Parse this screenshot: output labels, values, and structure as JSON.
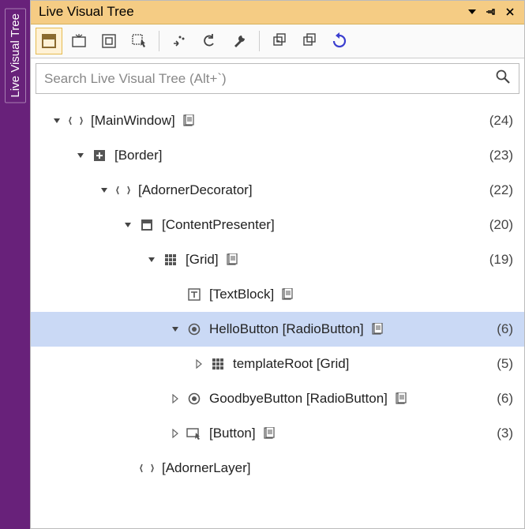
{
  "side_tab": {
    "label": "Live Visual Tree"
  },
  "title": "Live Visual Tree",
  "search": {
    "placeholder": "Search Live Visual Tree (Alt+`)"
  },
  "nodes": [
    {
      "indent": 0,
      "expander": "open",
      "icon": "element",
      "label": "[MainWindow]",
      "xaml": true,
      "count": "(24)",
      "selected": false
    },
    {
      "indent": 1,
      "expander": "open",
      "icon": "border",
      "label": "[Border]",
      "xaml": false,
      "count": "(23)",
      "selected": false
    },
    {
      "indent": 2,
      "expander": "open",
      "icon": "element",
      "label": "[AdornerDecorator]",
      "xaml": false,
      "count": "(22)",
      "selected": false
    },
    {
      "indent": 3,
      "expander": "open",
      "icon": "content",
      "label": "[ContentPresenter]",
      "xaml": false,
      "count": "(20)",
      "selected": false
    },
    {
      "indent": 4,
      "expander": "open",
      "icon": "grid",
      "label": "[Grid]",
      "xaml": true,
      "count": "(19)",
      "selected": false
    },
    {
      "indent": 5,
      "expander": "none",
      "icon": "text",
      "label": "[TextBlock]",
      "xaml": true,
      "count": "",
      "selected": false
    },
    {
      "indent": 5,
      "expander": "open",
      "icon": "radio",
      "label": "HelloButton [RadioButton]",
      "xaml": true,
      "count": "(6)",
      "selected": true
    },
    {
      "indent": 6,
      "expander": "closed",
      "icon": "grid",
      "label": "templateRoot [Grid]",
      "xaml": false,
      "count": "(5)",
      "selected": false
    },
    {
      "indent": 5,
      "expander": "closed",
      "icon": "radio",
      "label": "GoodbyeButton [RadioButton]",
      "xaml": true,
      "count": "(6)",
      "selected": false
    },
    {
      "indent": 5,
      "expander": "closed",
      "icon": "button",
      "label": "[Button]",
      "xaml": true,
      "count": "(3)",
      "selected": false
    },
    {
      "indent": 3,
      "expander": "none",
      "icon": "element",
      "label": "[AdornerLayer]",
      "xaml": false,
      "count": "",
      "selected": false
    }
  ]
}
